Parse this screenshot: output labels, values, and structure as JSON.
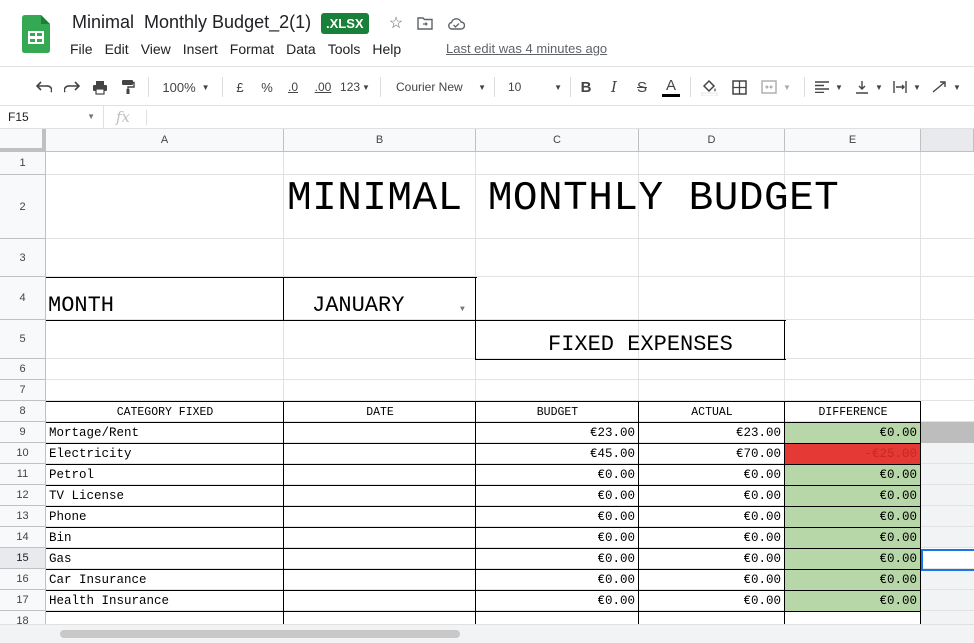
{
  "app": {
    "doc_title": "Minimal  Monthly Budget_2(1)",
    "file_badge": ".XLSX",
    "last_edit": "Last edit was 4 minutes ago",
    "menu": [
      "File",
      "Edit",
      "View",
      "Insert",
      "Format",
      "Data",
      "Tools",
      "Help"
    ]
  },
  "toolbar": {
    "zoom": "100%",
    "currency": "£",
    "percent": "%",
    "dec_decrease": ".0",
    "dec_increase": ".00",
    "number_format": "123",
    "font": "Courier New",
    "font_size": "10",
    "bold": "B",
    "italic": "I",
    "strike": "S",
    "text_color": "A"
  },
  "formula_bar": {
    "name_box": "F15",
    "fx": "fx"
  },
  "columns": [
    "A",
    "B",
    "C",
    "D",
    "E"
  ],
  "rows": [
    "1",
    "2",
    "3",
    "4",
    "5",
    "6",
    "7",
    "8",
    "9",
    "10",
    "11",
    "12",
    "13",
    "14",
    "15",
    "16",
    "17",
    "18"
  ],
  "sheet": {
    "title": "MINIMAL MONTHLY BUDGET",
    "month_label": "MONTH",
    "month_value": "JANUARY",
    "section_title": "FIXED EXPENSES",
    "headers": [
      "CATEGORY FIXED",
      "DATE",
      "BUDGET",
      "ACTUAL",
      "DIFFERENCE"
    ],
    "items": [
      {
        "category": "Mortage/Rent",
        "budget": "€23.00",
        "actual": "€23.00",
        "difference": "€0.00",
        "status": "ok"
      },
      {
        "category": "Electricity",
        "budget": "€45.00",
        "actual": "€70.00",
        "difference": "-€25.00",
        "status": "over"
      },
      {
        "category": "Petrol",
        "budget": "€0.00",
        "actual": "€0.00",
        "difference": "€0.00",
        "status": "ok"
      },
      {
        "category": "TV License",
        "budget": "€0.00",
        "actual": "€0.00",
        "difference": "€0.00",
        "status": "ok"
      },
      {
        "category": "Phone",
        "budget": "€0.00",
        "actual": "€0.00",
        "difference": "€0.00",
        "status": "ok"
      },
      {
        "category": "Bin",
        "budget": "€0.00",
        "actual": "€0.00",
        "difference": "€0.00",
        "status": "ok"
      },
      {
        "category": "Gas",
        "budget": "€0.00",
        "actual": "€0.00",
        "difference": "€0.00",
        "status": "ok"
      },
      {
        "category": "Car Insurance",
        "budget": "€0.00",
        "actual": "€0.00",
        "difference": "€0.00",
        "status": "ok"
      },
      {
        "category": "Health Insurance",
        "budget": "€0.00",
        "actual": "€0.00",
        "difference": "€0.00",
        "status": "ok"
      }
    ]
  },
  "colors": {
    "ok_fill": "#b7d7a8",
    "over_fill": "#e53935",
    "over_text": "#c62828",
    "badge": "#188038",
    "selection": "#1a73e8"
  }
}
